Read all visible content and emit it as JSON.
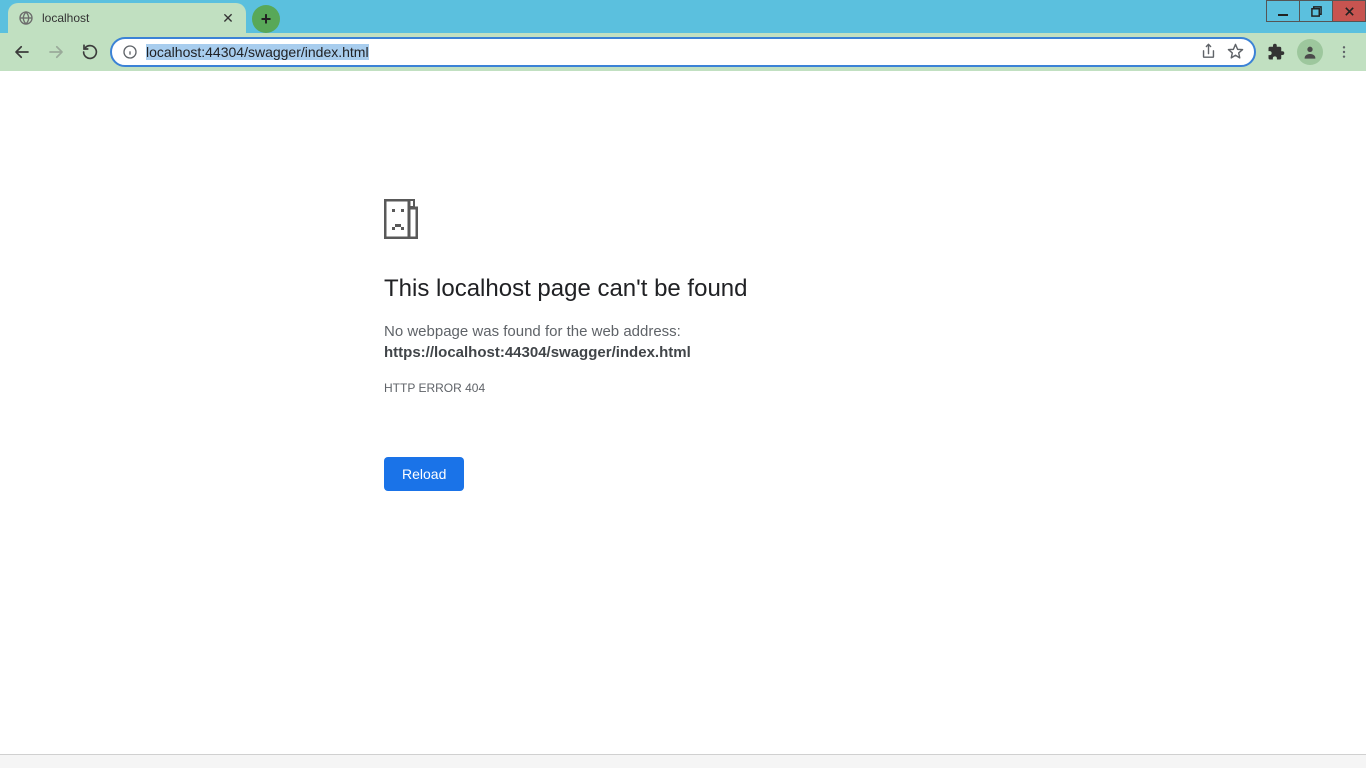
{
  "window": {
    "minimize_label": "_",
    "maximize_label": "❐",
    "close_label": "✕"
  },
  "tab": {
    "title": "localhost",
    "close_glyph": "✕"
  },
  "newtab": {
    "glyph": "+"
  },
  "toolbar": {
    "url_display": "localhost:44304/swagger/index.html"
  },
  "error": {
    "title": "This localhost page can't be found",
    "message": "No webpage was found for the web address:",
    "url": "https://localhost:44304/swagger/index.html",
    "code": "HTTP ERROR 404",
    "reload_label": "Reload"
  }
}
